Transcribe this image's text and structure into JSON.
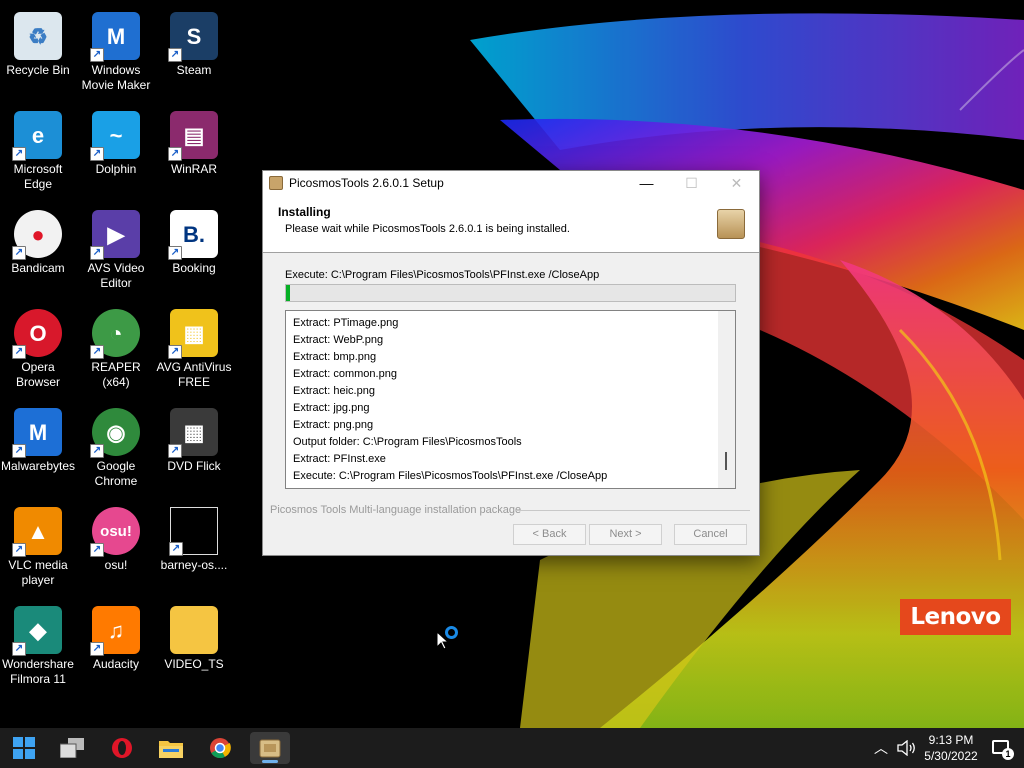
{
  "desktop": {
    "icons": [
      {
        "label": "Recycle Bin",
        "name": "recycle-bin-icon",
        "color": "#dce7ee",
        "glyph": "♻"
      },
      {
        "label": "Windows Movie Maker",
        "name": "movie-maker-icon",
        "color": "#1f6fd1",
        "glyph": "M"
      },
      {
        "label": "Steam",
        "name": "steam-icon",
        "color": "#1b3e66",
        "glyph": "S"
      },
      {
        "label": "Microsoft Edge",
        "name": "edge-icon",
        "color": "#1c8fd6",
        "glyph": "e"
      },
      {
        "label": "Dolphin",
        "name": "dolphin-icon",
        "color": "#1aa0e6",
        "glyph": "~"
      },
      {
        "label": "WinRAR",
        "name": "winrar-icon",
        "color": "#8b2a6d",
        "glyph": "▤"
      },
      {
        "label": "Bandicam",
        "name": "bandicam-icon",
        "color": "#f2f2f2",
        "glyph": "●"
      },
      {
        "label": "AVS Video Editor",
        "name": "avs-video-editor-icon",
        "color": "#5a3ea8",
        "glyph": "▶"
      },
      {
        "label": "Booking",
        "name": "booking-icon",
        "color": "#ffffff",
        "glyph": "B."
      },
      {
        "label": "Opera Browser",
        "name": "opera-icon",
        "color": "#d8182b",
        "glyph": "O"
      },
      {
        "label": "REAPER (x64)",
        "name": "reaper-icon",
        "color": "#3d9a46",
        "glyph": "◔"
      },
      {
        "label": "AVG AntiVirus FREE",
        "name": "avg-icon",
        "color": "#f0c21b",
        "glyph": "▦"
      },
      {
        "label": "Malwarebytes",
        "name": "malwarebytes-icon",
        "color": "#1d6fd6",
        "glyph": "M"
      },
      {
        "label": "Google Chrome",
        "name": "chrome-icon",
        "color": "#2f8a3c",
        "glyph": "◉"
      },
      {
        "label": "DVD Flick",
        "name": "dvd-flick-icon",
        "color": "#3a3a3a",
        "glyph": "▦"
      },
      {
        "label": "VLC media player",
        "name": "vlc-icon",
        "color": "#f08a00",
        "glyph": "▲"
      },
      {
        "label": "osu!",
        "name": "osu-icon",
        "color": "#e6488f",
        "glyph": "osu!"
      },
      {
        "label": "barney-os....",
        "name": "barney-file-icon",
        "color": "#000000",
        "glyph": ""
      },
      {
        "label": "Wondershare Filmora 11",
        "name": "filmora-icon",
        "color": "#1a8a7a",
        "glyph": "◆"
      },
      {
        "label": "Audacity",
        "name": "audacity-icon",
        "color": "#ff7a00",
        "glyph": "♫"
      },
      {
        "label": "VIDEO_TS",
        "name": "folder-icon",
        "color": "#f5c542",
        "glyph": ""
      }
    ]
  },
  "wallpaper": {
    "brand": "Lenovo"
  },
  "dialog": {
    "title": "PicosmosTools 2.6.0.1 Setup",
    "minimize": "—",
    "maximize": "☐",
    "close": "✕",
    "header_title": "Installing",
    "header_subtitle": "Please wait while PicosmosTools 2.6.0.1 is being installed.",
    "current_action": "Execute: C:\\Program Files\\PicosmosTools\\PFInst.exe /CloseApp",
    "progress": 0.01,
    "log": [
      "Extract: PTimage.png",
      "Extract: WebP.png",
      "Extract: bmp.png",
      "Extract: common.png",
      "Extract: heic.png",
      "Extract: jpg.png",
      "Extract: png.png",
      "Output folder: C:\\Program Files\\PicosmosTools",
      "Extract: PFInst.exe",
      "Execute: C:\\Program Files\\PicosmosTools\\PFInst.exe /CloseApp"
    ],
    "branding": "Picosmos Tools Multi-language installation package",
    "back_label": "< Back",
    "next_label": "Next >",
    "cancel_label": "Cancel"
  },
  "taskbar": {
    "items": [
      {
        "name": "start-icon",
        "active": false
      },
      {
        "name": "task-view-icon",
        "active": false
      },
      {
        "name": "opera-taskbar-icon",
        "active": false
      },
      {
        "name": "file-explorer-icon",
        "active": false
      },
      {
        "name": "chrome-taskbar-icon",
        "active": false
      },
      {
        "name": "picosmos-setup-taskbar-icon",
        "active": true
      }
    ],
    "time": "9:13 PM",
    "date": "5/30/2022",
    "notification_count": "1"
  }
}
